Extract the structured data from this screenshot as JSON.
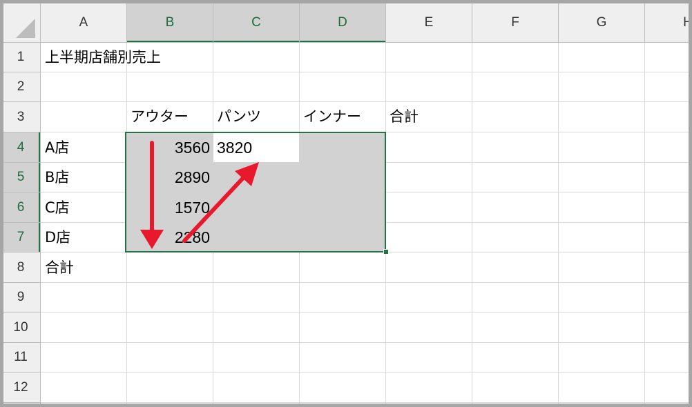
{
  "columns": [
    "A",
    "B",
    "C",
    "D",
    "E",
    "F",
    "G",
    "H"
  ],
  "rows": [
    "1",
    "2",
    "3",
    "4",
    "5",
    "6",
    "7",
    "8",
    "9",
    "10",
    "11",
    "12"
  ],
  "cells": {
    "A1": "上半期店舗別売上",
    "B3": "アウター",
    "C3": "パンツ",
    "D3": "インナー",
    "E3": "合計",
    "A4": "A店",
    "A5": "B店",
    "A6": "C店",
    "A7": "D店",
    "A8": "合計",
    "B4": "3560",
    "B5": "2890",
    "B6": "1570",
    "B7": "2280",
    "C4": "3820"
  },
  "selection": {
    "range": "B4:D7",
    "active_cell": "C4"
  },
  "colors": {
    "selection_border": "#217346",
    "selection_fill": "#d2d2d2",
    "header_bg": "#efefef",
    "header_selected_bg": "#d2d2d2",
    "gridline": "#d9d9d9",
    "arrow": "#e8192c"
  }
}
